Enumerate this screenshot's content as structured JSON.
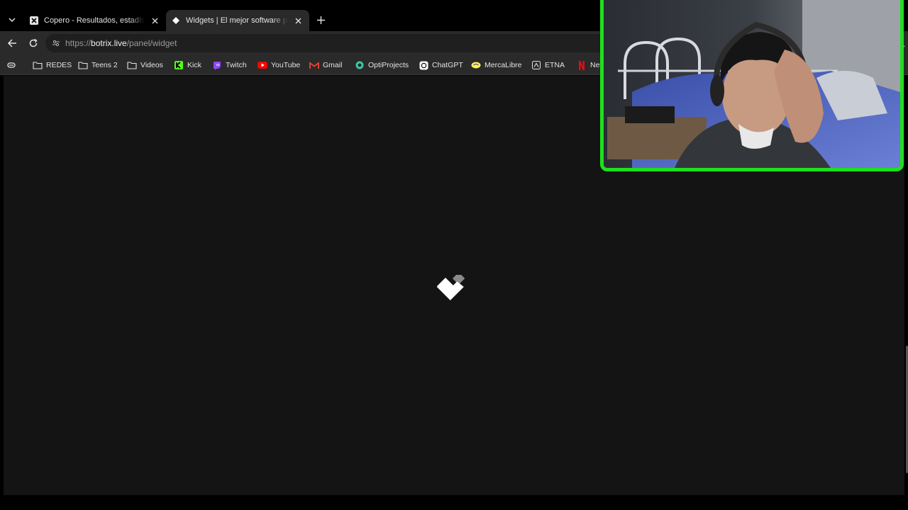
{
  "tabs": [
    {
      "title": "Copero - Resultados, estadísticas, ",
      "active": false,
      "favicon": "x-logo-icon"
    },
    {
      "title": "Widgets | El mejor software para p",
      "active": true,
      "favicon": "botrix-diamond-icon"
    }
  ],
  "toolbar": {
    "url_scheme": "https://",
    "url_host": "botrix.live",
    "url_path": "/panel/widget"
  },
  "bookmarks": [
    {
      "label": "REDES",
      "icon": "folder-icon"
    },
    {
      "label": "Teens 2",
      "icon": "folder-icon"
    },
    {
      "label": "Videos",
      "icon": "folder-icon"
    },
    {
      "label": "Kick",
      "icon": "kick-icon"
    },
    {
      "label": "Twitch",
      "icon": "twitch-icon"
    },
    {
      "label": "YouTube",
      "icon": "youtube-icon"
    },
    {
      "label": "Gmail",
      "icon": "gmail-icon"
    },
    {
      "label": "OptiProjects",
      "icon": "optiprojects-icon"
    },
    {
      "label": "ChatGPT",
      "icon": "chatgpt-icon"
    },
    {
      "label": "MercaLibre",
      "icon": "mercadolibre-icon"
    },
    {
      "label": "ETNA",
      "icon": "etna-icon"
    },
    {
      "label": "Net",
      "icon": "netflix-icon"
    }
  ],
  "colors": {
    "webcam_border": "#1ee01e",
    "page_background": "#141414",
    "chrome_background": "#2a2a2a"
  }
}
